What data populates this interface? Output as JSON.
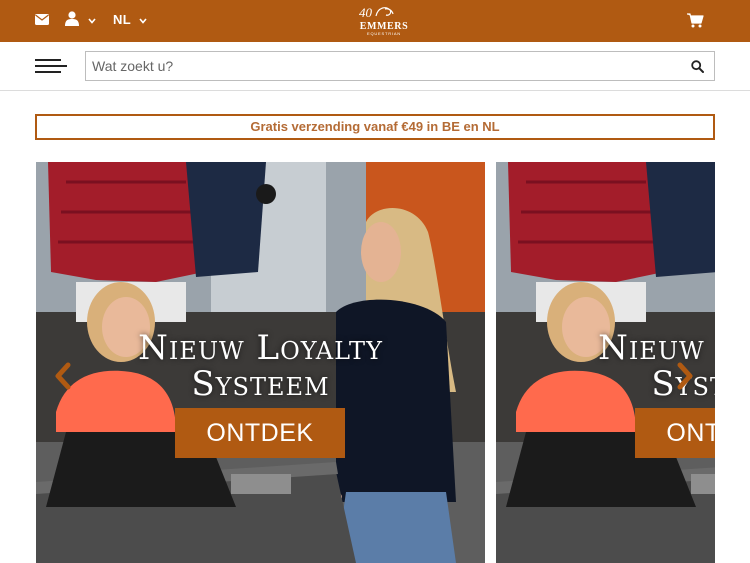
{
  "header": {
    "language": "NL",
    "logo": {
      "number": "40",
      "name": "EMMERS",
      "tagline": "EQUESTRIAN"
    },
    "icons": [
      "mail-icon",
      "user-icon",
      "chevron-down-icon",
      "cart-icon",
      "logo-icon"
    ]
  },
  "search": {
    "placeholder": "Wat zoekt u?",
    "value": ""
  },
  "banner": {
    "text": "Gratis verzending vanaf €49 in BE en NL"
  },
  "carousel": {
    "slides": [
      {
        "title_line1": "Nieuw Loyalty",
        "title_line2": "Systeem",
        "button": "ONTDEK"
      },
      {
        "title_line1": "Nieuw Loyalty",
        "title_line2": "Systeem",
        "button": "ONTDEK"
      }
    ]
  },
  "colors": {
    "brand": "#b05a12",
    "banner_text": "#b46b35"
  }
}
